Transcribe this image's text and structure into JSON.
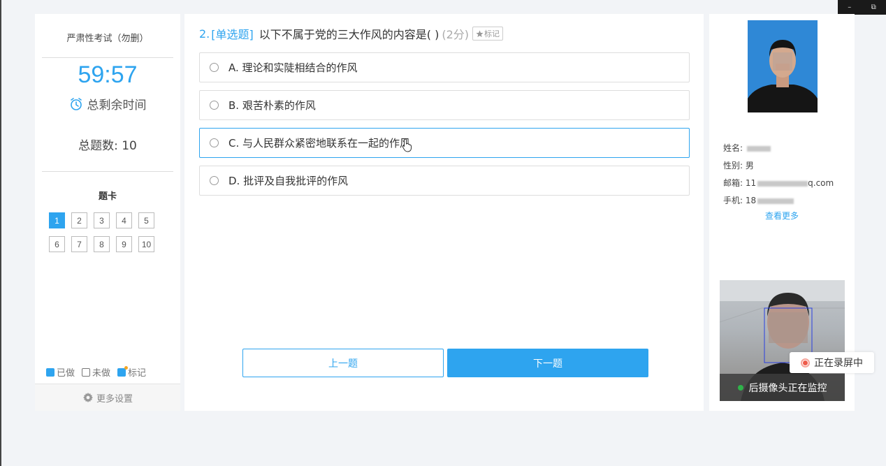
{
  "window_controls": {
    "minimize": "–",
    "restore": "⧉"
  },
  "sidebar": {
    "exam_title": "严肃性考试（勿删）",
    "timer": "59:57",
    "remaining_label": "总剩余时间",
    "total_label": "总题数: 10",
    "card_title": "题卡",
    "questions": [
      "1",
      "2",
      "3",
      "4",
      "5",
      "6",
      "7",
      "8",
      "9",
      "10"
    ],
    "active_question": "1",
    "legend": {
      "done": "已做",
      "undone": "未做",
      "marked": "标记"
    },
    "more_settings": "更多设置"
  },
  "question": {
    "number": "2.",
    "type": "[单选题]",
    "text": "以下不属于党的三大作风的内容是( )",
    "score": "(2分)",
    "mark_label": "标记",
    "options": [
      {
        "text": "A. 理论和实陡相结合的作风"
      },
      {
        "text": "B. 艰苦朴素的作风"
      },
      {
        "text": "C. 与人民群众紧密地联系在一起的作风"
      },
      {
        "text": "D. 批评及自我批评的作风"
      }
    ],
    "hovered_option": 2,
    "prev_label": "上一题",
    "next_label": "下一题"
  },
  "profile": {
    "name_label": "姓名:",
    "gender_label": "性别:",
    "gender_value": "男",
    "email_label": "邮箱:",
    "email_prefix": "11",
    "email_suffix": "q.com",
    "phone_label": "手机:",
    "phone_prefix": "18",
    "more_label": "查看更多"
  },
  "camera": {
    "status": "后摄像头正在监控",
    "recording": "正在录屏中"
  },
  "colors": {
    "accent": "#2ea4ef",
    "recording": "#ee5a4a",
    "camera_ok": "#2fb34a"
  }
}
